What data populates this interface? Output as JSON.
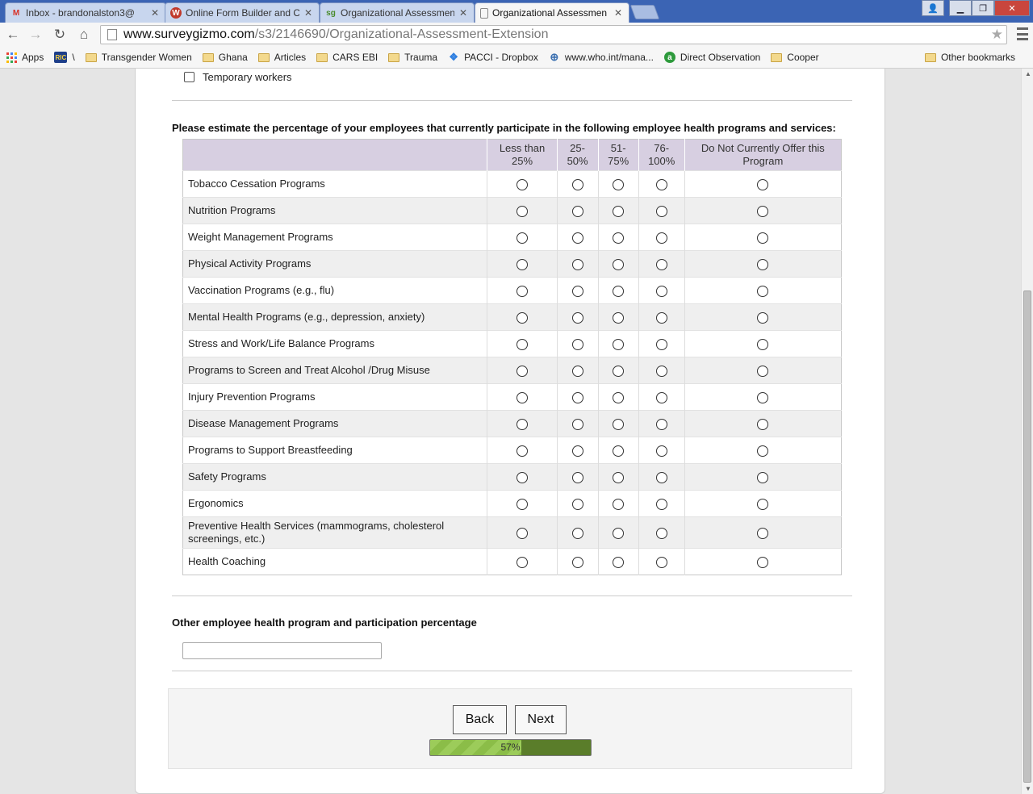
{
  "browser": {
    "tabs": [
      {
        "title": "Inbox - brandonalston3@",
        "icon": "gmail-icon",
        "active": false
      },
      {
        "title": "Online Form Builder and C",
        "icon": "wufoo-icon",
        "active": false
      },
      {
        "title": "Organizational Assessmen",
        "icon": "surveygizmo-icon",
        "active": false
      },
      {
        "title": "Organizational Assessmen",
        "icon": "page-icon",
        "active": true
      }
    ],
    "url_host": "www.surveygizmo.com",
    "url_path": "/s3/2146690/Organizational-Assessment-Extension",
    "bookmarks": [
      {
        "label": "Apps",
        "icon": "apps-grid-icon"
      },
      {
        "label": "\\",
        "icon": "ric-icon"
      },
      {
        "label": "Transgender Women",
        "icon": "folder-icon"
      },
      {
        "label": "Ghana",
        "icon": "folder-icon"
      },
      {
        "label": "Articles",
        "icon": "folder-icon"
      },
      {
        "label": "CARS EBI",
        "icon": "folder-icon"
      },
      {
        "label": "Trauma",
        "icon": "folder-icon"
      },
      {
        "label": "PACCI - Dropbox",
        "icon": "dropbox-icon"
      },
      {
        "label": "www.who.int/mana...",
        "icon": "who-icon"
      },
      {
        "label": "Direct Observation",
        "icon": "green-a-icon"
      },
      {
        "label": "Cooper",
        "icon": "folder-icon"
      }
    ],
    "other_bookmarks": "Other bookmarks"
  },
  "survey": {
    "prev_option": "Temporary workers",
    "question": "Please estimate the percentage of your employees that currently participate in the following employee health programs and services:",
    "columns": [
      "Less than 25%",
      "25-50%",
      "51-75%",
      "76-100%",
      "Do Not Currently Offer this Program"
    ],
    "column_display": [
      [
        "Less than",
        "25%"
      ],
      [
        "25-",
        "50%"
      ],
      [
        "51-",
        "75%"
      ],
      [
        "76-",
        "100%"
      ],
      [
        "Do Not Currently Offer this",
        "Program"
      ]
    ],
    "rows": [
      "Tobacco Cessation Programs",
      "Nutrition Programs",
      "Weight Management Programs",
      "Physical Activity Programs",
      "Vaccination Programs (e.g., flu)",
      "Mental Health Programs (e.g., depression, anxiety)",
      "Stress and Work/Life Balance Programs",
      "Programs to Screen and Treat Alcohol /Drug Misuse",
      "Injury Prevention Programs",
      "Disease Management Programs",
      "Programs to Support Breastfeeding",
      "Safety Programs",
      "Ergonomics",
      "Preventive Health Services (mammograms, cholesterol screenings, etc.)",
      "Health Coaching"
    ],
    "other_question": "Other employee health program and participation percentage",
    "other_value": "",
    "back_label": "Back",
    "next_label": "Next",
    "progress_percent": 57,
    "progress_label": "57%"
  },
  "colors": {
    "header_bg": "#d7cfe1",
    "progress_fill": "#9ccc5a",
    "progress_track": "#5a7d2a"
  }
}
